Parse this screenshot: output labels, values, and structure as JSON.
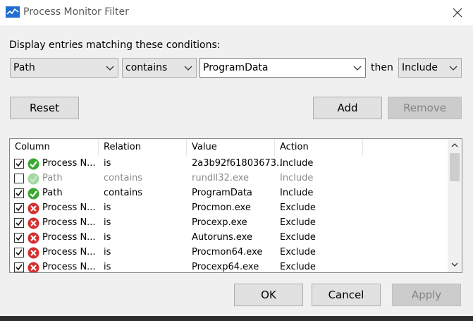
{
  "window": {
    "title": "Process Monitor Filter"
  },
  "filter": {
    "prompt": "Display entries matching these conditions:",
    "column": "Path",
    "relation": "contains",
    "value": "ProgramData",
    "then_label": "then",
    "action": "Include"
  },
  "buttons": {
    "reset": "Reset",
    "add": "Add",
    "remove": "Remove",
    "ok": "OK",
    "cancel": "Cancel",
    "apply": "Apply"
  },
  "list": {
    "headers": [
      "Column",
      "Relation",
      "Value",
      "Action"
    ],
    "rows": [
      {
        "checked": true,
        "status": "include",
        "column": "Process N...",
        "relation": "is",
        "value": "2a3b92f61803673...",
        "action": "Include",
        "muted": false
      },
      {
        "checked": false,
        "status": "include",
        "column": "Path",
        "relation": "contains",
        "value": "rundll32.exe",
        "action": "Include",
        "muted": true
      },
      {
        "checked": true,
        "status": "include",
        "column": "Path",
        "relation": "contains",
        "value": "ProgramData",
        "action": "Include",
        "muted": false
      },
      {
        "checked": true,
        "status": "exclude",
        "column": "Process N...",
        "relation": "is",
        "value": "Procmon.exe",
        "action": "Exclude",
        "muted": false
      },
      {
        "checked": true,
        "status": "exclude",
        "column": "Process N...",
        "relation": "is",
        "value": "Procexp.exe",
        "action": "Exclude",
        "muted": false
      },
      {
        "checked": true,
        "status": "exclude",
        "column": "Process N...",
        "relation": "is",
        "value": "Autoruns.exe",
        "action": "Exclude",
        "muted": false
      },
      {
        "checked": true,
        "status": "exclude",
        "column": "Process N...",
        "relation": "is",
        "value": "Procmon64.exe",
        "action": "Exclude",
        "muted": false
      },
      {
        "checked": true,
        "status": "exclude",
        "column": "Process N...",
        "relation": "is",
        "value": "Procexp64.exe",
        "action": "Exclude",
        "muted": false
      }
    ]
  },
  "colors": {
    "include_green": "#3aa832",
    "exclude_red": "#d42f2f",
    "muted": "#8a8a8a"
  },
  "icons": {
    "app": "process-monitor-icon",
    "close": "close-icon"
  }
}
